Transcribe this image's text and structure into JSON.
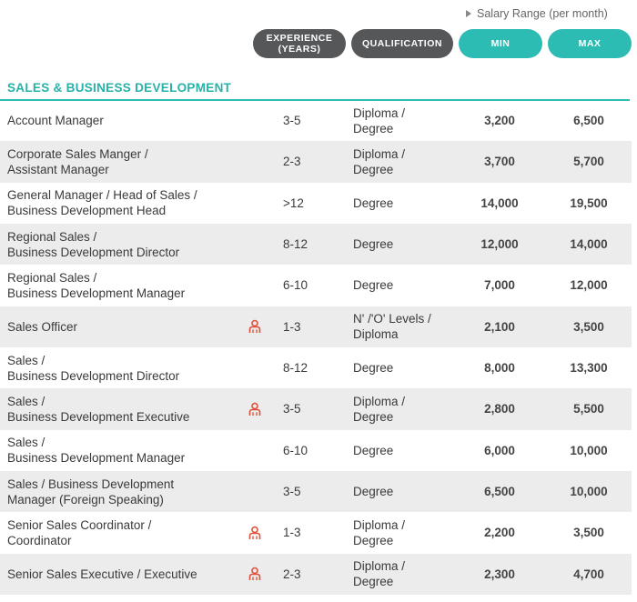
{
  "header": {
    "salary_range": "Salary Range (per month)",
    "col_experience_1": "EXPERIENCE",
    "col_experience_2": "(YEARS)",
    "col_qualification": "QUALIFICATION",
    "col_min": "MIN",
    "col_max": "MAX"
  },
  "section": {
    "title": "SALES & BUSINESS DEVELOPMENT"
  },
  "colors": {
    "teal": "#2dbcb3",
    "dark_pill": "#555759",
    "icon_red": "#e0513c"
  },
  "rows": [
    {
      "t1": "Account Manager",
      "t2": "",
      "icon": false,
      "exp": "3-5",
      "q1": "Diploma /",
      "q2": "Degree",
      "min": "3,200",
      "max": "6,500"
    },
    {
      "t1": "Corporate Sales Manger /",
      "t2": "Assistant Manager",
      "icon": false,
      "exp": "2-3",
      "q1": "Diploma /",
      "q2": "Degree",
      "min": "3,700",
      "max": "5,700"
    },
    {
      "t1": "General Manager / Head of Sales /",
      "t2": "Business Development Head",
      "icon": false,
      "exp": ">12",
      "q1": "Degree",
      "q2": "",
      "min": "14,000",
      "max": "19,500"
    },
    {
      "t1": "Regional Sales /",
      "t2": "Business Development Director",
      "icon": false,
      "exp": "8-12",
      "q1": "Degree",
      "q2": "",
      "min": "12,000",
      "max": "14,000"
    },
    {
      "t1": "Regional Sales /",
      "t2": "Business Development Manager",
      "icon": false,
      "exp": "6-10",
      "q1": "Degree",
      "q2": "",
      "min": "7,000",
      "max": "12,000"
    },
    {
      "t1": "Sales Officer",
      "t2": "",
      "icon": true,
      "exp": "1-3",
      "q1": "N' /'O' Levels /",
      "q2": "Diploma",
      "min": "2,100",
      "max": "3,500"
    },
    {
      "t1": "Sales /",
      "t2": "Business Development Director",
      "icon": false,
      "exp": "8-12",
      "q1": "Degree",
      "q2": "",
      "min": "8,000",
      "max": "13,300"
    },
    {
      "t1": "Sales /",
      "t2": "Business Development Executive",
      "icon": true,
      "exp": "3-5",
      "q1": "Diploma /",
      "q2": "Degree",
      "min": "2,800",
      "max": "5,500"
    },
    {
      "t1": "Sales /",
      "t2": "Business Development Manager",
      "icon": false,
      "exp": "6-10",
      "q1": "Degree",
      "q2": "",
      "min": "6,000",
      "max": "10,000"
    },
    {
      "t1": "Sales / Business Development",
      "t2": "Manager (Foreign Speaking)",
      "icon": false,
      "exp": "3-5",
      "q1": "Degree",
      "q2": "",
      "min": "6,500",
      "max": "10,000"
    },
    {
      "t1": "Senior Sales Coordinator /",
      "t2": "Coordinator",
      "icon": true,
      "exp": "1-3",
      "q1": "Diploma /",
      "q2": "Degree",
      "min": "2,200",
      "max": "3,500"
    },
    {
      "t1": "Senior Sales Executive / Executive",
      "t2": "",
      "icon": true,
      "exp": "2-3",
      "q1": "Diploma /",
      "q2": "Degree",
      "min": "2,300",
      "max": "4,700"
    }
  ]
}
